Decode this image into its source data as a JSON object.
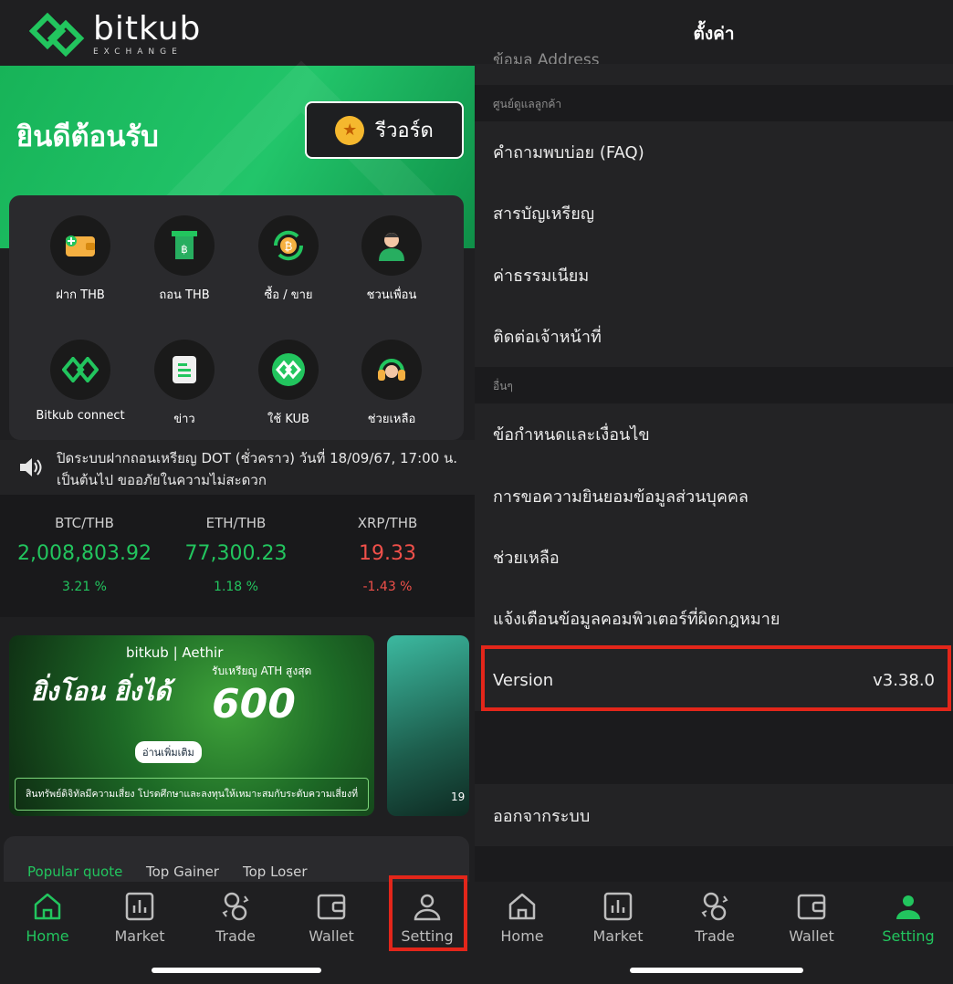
{
  "left": {
    "brand": {
      "name": "bitkub",
      "sub": "EXCHANGE"
    },
    "hero": {
      "welcome": "ยินดีต้อนรับ",
      "reward_label": "รีวอร์ด"
    },
    "menu": [
      {
        "label": "ฝาก THB",
        "icon": "wallet-deposit-icon"
      },
      {
        "label": "ถอน THB",
        "icon": "withdraw-icon"
      },
      {
        "label": "ซื้อ / ขาย",
        "icon": "buy-sell-icon"
      },
      {
        "label": "ชวนเพื่อน",
        "icon": "invite-friend-icon"
      },
      {
        "label": "Bitkub connect",
        "icon": "bitkub-connect-icon"
      },
      {
        "label": "ข่าว",
        "icon": "news-icon"
      },
      {
        "label": "ใช้ KUB",
        "icon": "kub-icon"
      },
      {
        "label": "ช่วยเหลือ",
        "icon": "support-headset-icon"
      }
    ],
    "notice": "ปิดระบบฝากถอนเหรียญ DOT (ชั่วคราว) วันที่ 18/09/67, 17:00 น. เป็นต้นไป ขออภัยในความไม่สะดวก",
    "tickers": [
      {
        "pair": "BTC/THB",
        "price": "2,008,803.92",
        "change": "3.21 %",
        "trend": "up"
      },
      {
        "pair": "ETH/THB",
        "price": "77,300.23",
        "change": "1.18 %",
        "trend": "up"
      },
      {
        "pair": "XRP/THB",
        "price": "19.33",
        "change": "-1.43 %",
        "trend": "down"
      }
    ],
    "banner": {
      "brand_line": "bitkub | Aethir",
      "headline": "รับเหรียญ ATH สูงสุด",
      "amount": "600",
      "slogan": "ยิ่งโอน ยิ่งได้",
      "button": "อ่านเพิ่มเติม",
      "footer": "สินทรัพย์ดิจิทัลมีความเสี่ยง โปรดศึกษาและลงทุนให้เหมาะสมกับระดับความเสี่ยงที่ยอมรับได้",
      "next_peek": "19"
    },
    "quote_tabs": [
      "Popular quote",
      "Top Gainer",
      "Top Loser"
    ],
    "tabs": [
      {
        "label": "Home",
        "icon": "home-icon",
        "active": true
      },
      {
        "label": "Market",
        "icon": "market-chart-icon",
        "active": false
      },
      {
        "label": "Trade",
        "icon": "trade-exchange-icon",
        "active": false
      },
      {
        "label": "Wallet",
        "icon": "wallet-icon",
        "active": false
      },
      {
        "label": "Setting",
        "icon": "user-icon",
        "active": false
      }
    ]
  },
  "right": {
    "title": "ตั้งค่า",
    "cut_row": "ข้อมูล Address",
    "section_support": "ศูนย์ดูแลลูกค้า",
    "support_rows": [
      "คำถามพบบ่อย (FAQ)",
      "สารบัญเหรียญ",
      "ค่าธรรมเนียม",
      "ติดต่อเจ้าหน้าที่"
    ],
    "section_other": "อื่นๆ",
    "other_rows": [
      "ข้อกำหนดและเงื่อนไข",
      "การขอความยินยอมข้อมูลส่วนบุคคล",
      "ช่วยเหลือ",
      "แจ้งเตือนข้อมูลคอมพิวเตอร์ที่ผิดกฎหมาย"
    ],
    "version_label": "Version",
    "version_value": "v3.38.0",
    "logout": "ออกจากระบบ",
    "tabs": [
      {
        "label": "Home",
        "icon": "home-icon",
        "active": false
      },
      {
        "label": "Market",
        "icon": "market-chart-icon",
        "active": false
      },
      {
        "label": "Trade",
        "icon": "trade-exchange-icon",
        "active": false
      },
      {
        "label": "Wallet",
        "icon": "wallet-icon",
        "active": false
      },
      {
        "label": "Setting",
        "icon": "user-icon",
        "active": true
      }
    ]
  },
  "colors": {
    "accent": "#22c55e",
    "negative": "#f0504a",
    "highlight": "#e3261a"
  }
}
